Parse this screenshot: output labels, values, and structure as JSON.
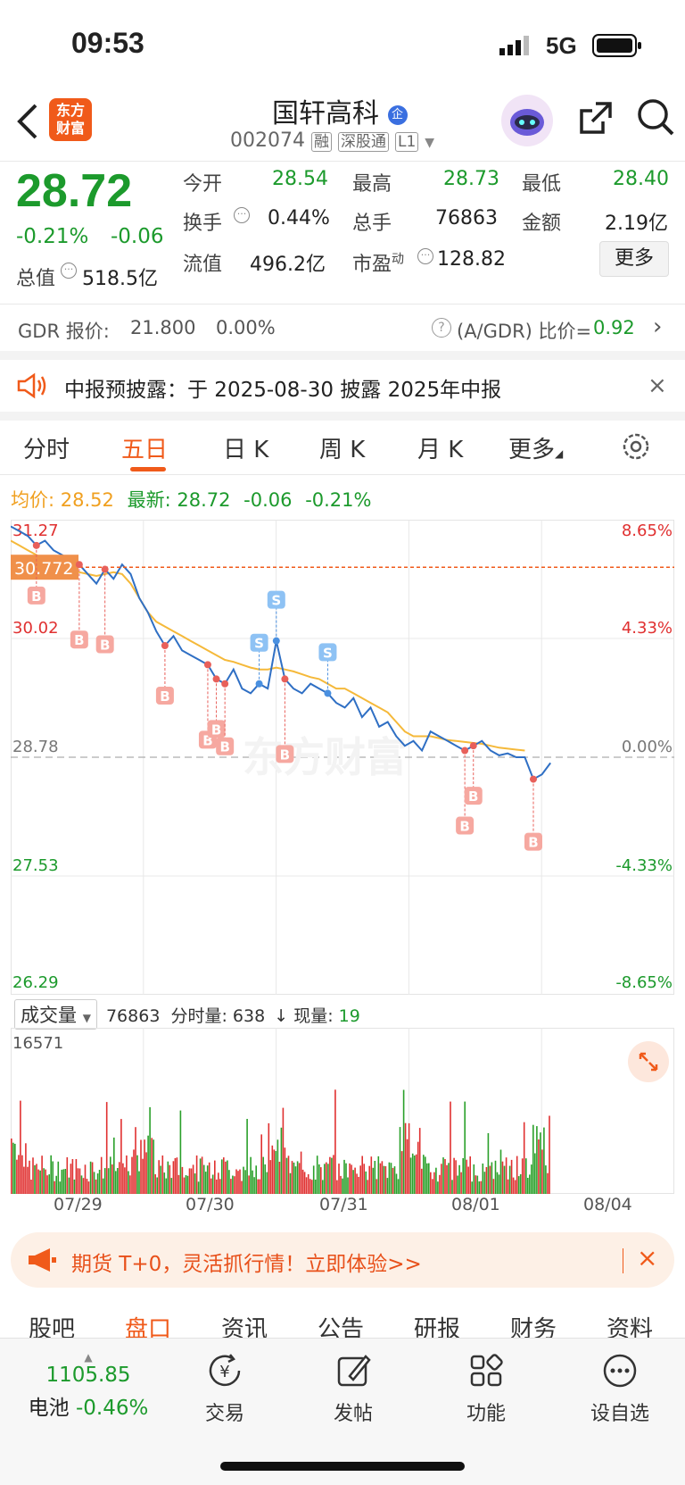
{
  "status": {
    "time": "09:53",
    "network": "5G"
  },
  "header": {
    "name": "国轩高科",
    "badge": "企",
    "code": "002074",
    "tags": [
      "融",
      "深股通",
      "L1"
    ],
    "logo_top": "东方",
    "logo_bottom": "财富"
  },
  "quote": {
    "price": "28.72",
    "change_pct": "-0.21%",
    "change": "-0.06",
    "open_label": "今开",
    "open": "28.54",
    "high_label": "最高",
    "high": "28.73",
    "low_label": "最低",
    "low": "28.40",
    "turnover_label": "换手",
    "turnover": "0.44%",
    "volume_label": "总手",
    "volume": "76863",
    "amount_label": "金额",
    "amount": "2.19亿",
    "mktcap_label": "总值",
    "mktcap": "518.5亿",
    "float_label": "流值",
    "float": "496.2亿",
    "pe_label": "市盈",
    "pe_sup": "动",
    "pe": "128.82",
    "more_label": "更多"
  },
  "gdr": {
    "label": "GDR 报价:",
    "price": "21.800",
    "pct": "0.00%",
    "ratio_label": "(A/GDR) 比价=",
    "ratio": "0.92"
  },
  "notice": {
    "text": "中报预披露：于 2025-08-30 披露 2025年中报"
  },
  "tabs": [
    "分时",
    "五日",
    "日 K",
    "周 K",
    "月 K",
    "更多"
  ],
  "active_tab": "五日",
  "legend": {
    "avg_label": "均价:",
    "avg": "28.52",
    "latest_label": "最新:",
    "latest": "28.72",
    "chg": "-0.06",
    "pct": "-0.21%"
  },
  "chart_data": {
    "type": "line",
    "title": "",
    "x": [
      "07/29",
      "07/30",
      "07/31",
      "08/01",
      "08/04"
    ],
    "y_left_ticks": [
      "31.27",
      "30.02",
      "28.78",
      "27.53",
      "26.29"
    ],
    "y_right_ticks": [
      "8.65%",
      "4.33%",
      "0.00%",
      "-4.33%",
      "-8.65%"
    ],
    "ylim": [
      26.29,
      31.27
    ],
    "reference_price": 28.78,
    "crosshair_label": "30.772",
    "series": [
      {
        "values": [
          31.2,
          31.15,
          31.1,
          31.0,
          31.05,
          30.95,
          30.9,
          30.85,
          30.8,
          30.7,
          30.6,
          30.75,
          30.65,
          30.8,
          30.7,
          30.45,
          30.3,
          30.1,
          29.95,
          30.05,
          29.9,
          29.85,
          29.8,
          29.75,
          29.6,
          29.55,
          29.7,
          29.5,
          29.45,
          29.55,
          29.5,
          30.0,
          29.6,
          29.5,
          29.45,
          29.55,
          29.5,
          29.45,
          29.35,
          29.3,
          29.4,
          29.2,
          29.3,
          29.1,
          29.15,
          29.0,
          28.9,
          28.95,
          28.85,
          29.05,
          29.0,
          28.95,
          28.9,
          28.85,
          28.9,
          28.95,
          28.85,
          28.8,
          28.82,
          28.78,
          28.78,
          28.55,
          28.6,
          28.72
        ]
      },
      {
        "values": [
          31.05,
          31.0,
          30.95,
          30.9,
          30.85,
          30.8,
          30.78,
          30.75,
          30.72,
          30.7,
          30.68,
          30.7,
          30.72,
          30.7,
          30.6,
          30.45,
          30.3,
          30.2,
          30.15,
          30.1,
          30.05,
          30.0,
          29.95,
          29.9,
          29.85,
          29.8,
          29.78,
          29.75,
          29.72,
          29.7,
          29.7,
          29.72,
          29.7,
          29.68,
          29.65,
          29.62,
          29.6,
          29.55,
          29.5,
          29.5,
          29.45,
          29.4,
          29.35,
          29.3,
          29.25,
          29.15,
          29.05,
          29.0,
          29.0,
          29.0,
          28.98,
          28.96,
          28.95,
          28.94,
          28.93,
          28.92,
          28.9,
          28.88,
          28.87,
          28.86,
          28.85
        ]
      }
    ],
    "markers": [
      {
        "label": "B",
        "i": 3
      },
      {
        "label": "B",
        "i": 8
      },
      {
        "label": "B",
        "i": 11
      },
      {
        "label": "B",
        "i": 18
      },
      {
        "label": "B",
        "i": 23
      },
      {
        "label": "B",
        "i": 24
      },
      {
        "label": "B",
        "i": 25
      },
      {
        "label": "S",
        "i": 29
      },
      {
        "label": "S",
        "i": 31
      },
      {
        "label": "B",
        "i": 32
      },
      {
        "label": "S",
        "i": 37
      },
      {
        "label": "B",
        "i": 53
      },
      {
        "label": "B",
        "i": 54
      },
      {
        "label": "B",
        "i": 61
      }
    ]
  },
  "volume": {
    "label": "成交量",
    "total": "76863",
    "fs_label": "分时量:",
    "fs": "638",
    "now_label": "现量:",
    "now": "19",
    "max": "16571"
  },
  "promo": {
    "text": "期货 T+0，灵活抓行情！立即体验>>"
  },
  "bottom_tabs": [
    "股吧",
    "盘口",
    "资讯",
    "公告",
    "研报",
    "财务",
    "资料"
  ],
  "active_bottom_tab": "盘口",
  "toolbar": {
    "index_value": "1105.85",
    "index_name": "电池",
    "index_pct": "-0.46%",
    "trade": "交易",
    "post": "发帖",
    "func": "功能",
    "watch": "设自选"
  },
  "colors": {
    "red": "#e03030",
    "green": "#1c9a2c",
    "orange": "#f05a1a",
    "blue": "#2f6fc4",
    "avg": "#f5b93a"
  }
}
